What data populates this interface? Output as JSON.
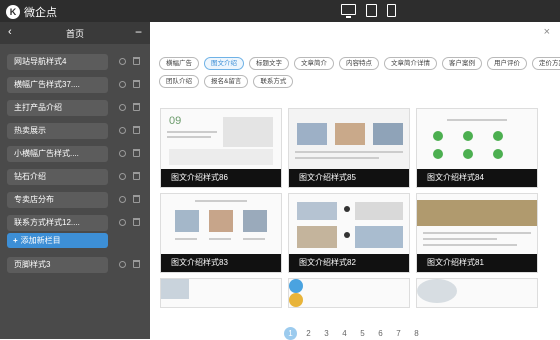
{
  "app": {
    "logo_mark": "K",
    "logo_text": "微企点"
  },
  "sidebar": {
    "back_symbol": "‹",
    "title": "首页",
    "minimize_symbol": "−",
    "items": [
      {
        "label": "网站导航样式4"
      },
      {
        "label": "横幅广告样式37...."
      },
      {
        "label": "主打产品介绍"
      },
      {
        "label": "热卖展示"
      },
      {
        "label": "小横幅广告样式...."
      },
      {
        "label": "钻石介绍"
      },
      {
        "label": "专卖店分布"
      },
      {
        "label": "联系方式样式12...."
      }
    ],
    "add_button": "添加新栏目",
    "add_symbol": "+",
    "footer_item": "页脚样式3"
  },
  "panel": {
    "close_symbol": "×",
    "tags_row1": [
      "横幅广告",
      "图文介绍",
      "标题文字",
      "文章简介",
      "内容特点",
      "文章简介详情",
      "客户案例",
      "用户评价",
      "定价方案"
    ],
    "tags_row2": [
      "团队介绍",
      "报名&留言",
      "联系方式"
    ],
    "active_tag": "图文介绍",
    "templates": [
      {
        "caption": "图文介绍样式86"
      },
      {
        "caption": "图文介绍样式85"
      },
      {
        "caption": "图文介绍样式84"
      },
      {
        "caption": "图文介绍样式83"
      },
      {
        "caption": "图文介绍样式82"
      },
      {
        "caption": "图文介绍样式81"
      }
    ],
    "pagination": [
      "1",
      "2",
      "3",
      "4",
      "5",
      "6",
      "7",
      "8"
    ],
    "current_page": "1"
  }
}
